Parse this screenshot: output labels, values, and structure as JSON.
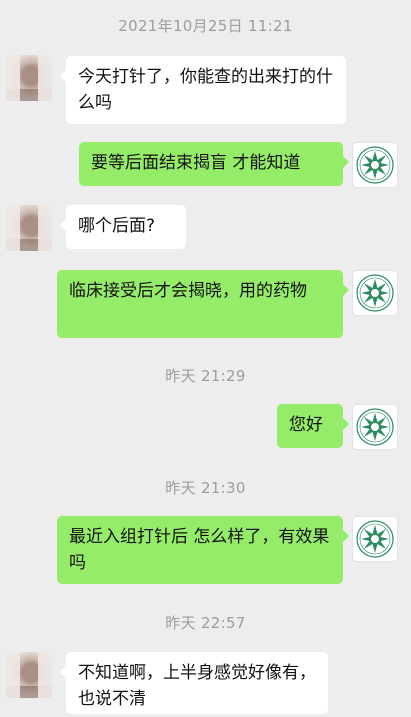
{
  "colors": {
    "background": "#ededed",
    "outgoing_bubble": "#95ec69",
    "incoming_bubble": "#ffffff",
    "timestamp_text": "#9d9d9d",
    "logo_green": "#2e8b62"
  },
  "messages": [
    {
      "type": "timestamp",
      "text": "2021年10月25日 11:21"
    },
    {
      "type": "incoming",
      "text": "今天打针了，你能查的出来打的什么吗"
    },
    {
      "type": "outgoing",
      "text": "要等后面结束揭盲 才能知道"
    },
    {
      "type": "incoming",
      "text": "哪个后面?"
    },
    {
      "type": "outgoing",
      "text": "临床接受后才会揭晓，用的药物"
    },
    {
      "type": "timestamp",
      "text": "昨天 21:29"
    },
    {
      "type": "outgoing",
      "text": "您好"
    },
    {
      "type": "timestamp",
      "text": "昨天 21:30"
    },
    {
      "type": "outgoing",
      "text": "最近入组打针后 怎么样了，有效果吗"
    },
    {
      "type": "timestamp",
      "text": "昨天 22:57"
    },
    {
      "type": "incoming",
      "text": "不知道啊，上半身感觉好像有，也说不清"
    }
  ],
  "icons": {
    "user_avatar": "blurred-user-avatar-icon",
    "self_avatar": "green-emblem-avatar-icon"
  }
}
